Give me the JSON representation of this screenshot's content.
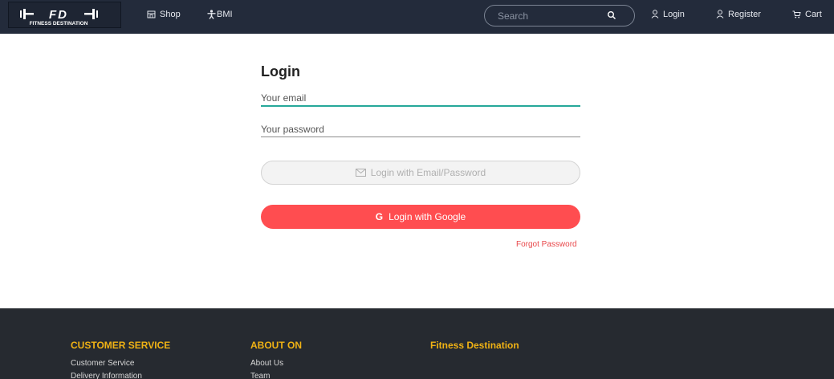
{
  "navbar": {
    "logo": {
      "mark": "I-FD-I",
      "subtitle": "FITNESS DESTINATION"
    },
    "shop_label": "Shop",
    "bmi_label": "BMI",
    "search": {
      "placeholder": "Search",
      "value": ""
    },
    "login_label": "Login",
    "register_label": "Register",
    "cart_label": "Cart"
  },
  "login": {
    "title": "Login",
    "email": {
      "placeholder": "Your email",
      "value": ""
    },
    "password": {
      "placeholder": "Your password",
      "value": ""
    },
    "email_button_label": "Login with Email/Password",
    "google_button_label": "Login with Google",
    "google_icon": "G",
    "forgot_label": "Forgot Password"
  },
  "footer": {
    "col1": {
      "heading": "CUSTOMER SERVICE",
      "links": [
        "Customer Service",
        "Delivery Information"
      ]
    },
    "col2": {
      "heading": "ABOUT ON",
      "links": [
        "About Us",
        "Team"
      ]
    },
    "col3": {
      "heading": "Fitness Destination"
    }
  },
  "colors": {
    "navbar_bg": "#232b3b",
    "accent_red": "#ff4d50",
    "focus_teal": "#26a89a",
    "footer_heading": "#f0b214",
    "footer_bg": "#262a30"
  },
  "icons": {
    "shop": "store-icon",
    "bmi": "person-icon",
    "search": "search-icon",
    "login": "user-icon",
    "register": "user-icon",
    "cart": "cart-icon",
    "email_button": "envelope-icon",
    "google_button": "google-icon"
  }
}
